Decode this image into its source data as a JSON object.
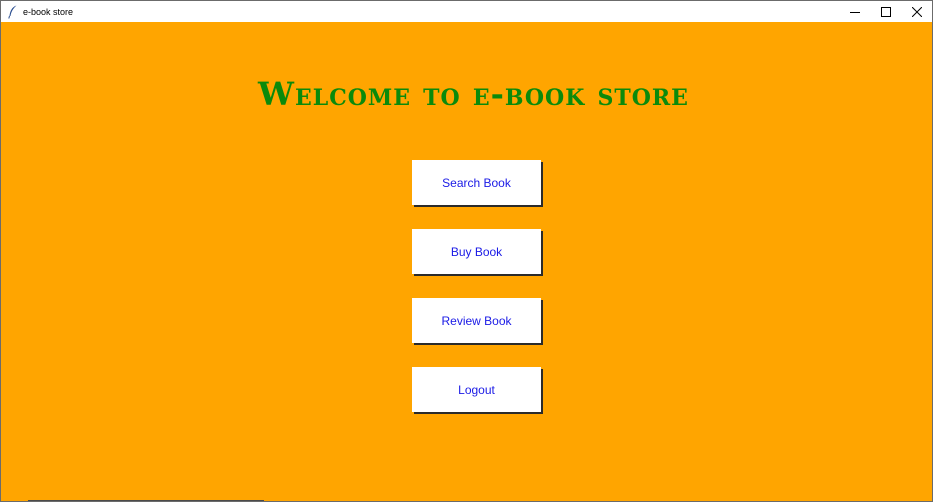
{
  "window": {
    "title": "e-book store",
    "icon": "feather-icon",
    "controls": [
      "minimize-icon",
      "maximize-icon",
      "close-icon"
    ]
  },
  "main": {
    "heading": "Welcome to e-book store",
    "buttons": [
      {
        "label": "Search Book"
      },
      {
        "label": "Buy Book"
      },
      {
        "label": "Review Book"
      },
      {
        "label": "Logout"
      }
    ]
  },
  "colors": {
    "background": "#FFA500",
    "heading": "#0B8A0B",
    "button_text": "#1A1AE6",
    "button_bg": "#FFFFFF"
  }
}
